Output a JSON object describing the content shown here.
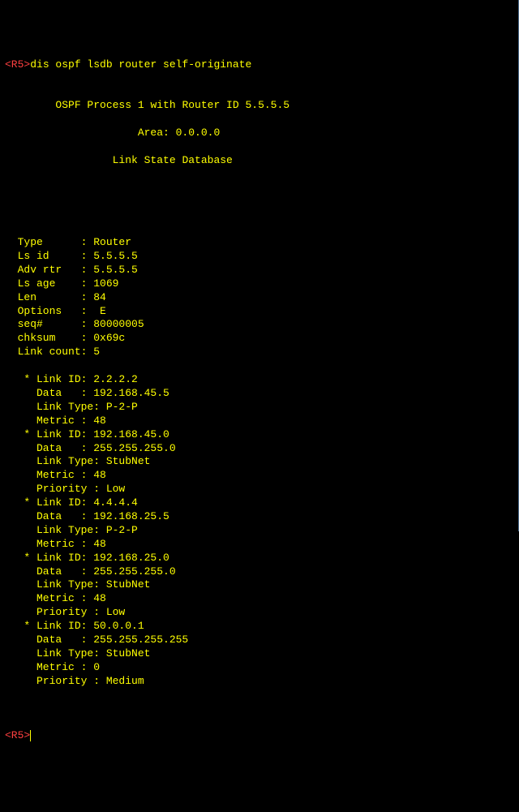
{
  "prompt": {
    "host": "<R5>",
    "command": "dis ospf lsdb router self-originate",
    "end_host": "<R5>"
  },
  "header": {
    "line1": "OSPF Process 1 with Router ID 5.5.5.5",
    "line2": "Area: 0.0.0.0",
    "line3": "Link State Database"
  },
  "fields": [
    {
      "label": "Type      ",
      "sep": ": ",
      "value": "Router"
    },
    {
      "label": "Ls id     ",
      "sep": ": ",
      "value": "5.5.5.5"
    },
    {
      "label": "Adv rtr   ",
      "sep": ": ",
      "value": "5.5.5.5"
    },
    {
      "label": "Ls age    ",
      "sep": ": ",
      "value": "1069"
    },
    {
      "label": "Len       ",
      "sep": ": ",
      "value": "84"
    },
    {
      "label": "Options   ",
      "sep": ":  ",
      "value": "E"
    },
    {
      "label": "seq#      ",
      "sep": ": ",
      "value": "80000005"
    },
    {
      "label": "chksum    ",
      "sep": ": ",
      "value": "0x69c"
    },
    {
      "label": "Link count",
      "sep": ": ",
      "value": "5"
    }
  ],
  "links": [
    {
      "rows": [
        {
          "label": "* Link ID",
          "sep": ": ",
          "value": "2.2.2.2"
        },
        {
          "label": "  Data   ",
          "sep": ": ",
          "value": "192.168.45.5"
        },
        {
          "label": "  Link Type",
          "sep": ": ",
          "value": "P-2-P"
        },
        {
          "label": "  Metric ",
          "sep": ": ",
          "value": "48"
        }
      ]
    },
    {
      "rows": [
        {
          "label": "* Link ID",
          "sep": ": ",
          "value": "192.168.45.0"
        },
        {
          "label": "  Data   ",
          "sep": ": ",
          "value": "255.255.255.0"
        },
        {
          "label": "  Link Type",
          "sep": ": ",
          "value": "StubNet"
        },
        {
          "label": "  Metric ",
          "sep": ": ",
          "value": "48"
        },
        {
          "label": "  Priority ",
          "sep": ": ",
          "value": "Low"
        }
      ]
    },
    {
      "rows": [
        {
          "label": "* Link ID",
          "sep": ": ",
          "value": "4.4.4.4"
        },
        {
          "label": "  Data   ",
          "sep": ": ",
          "value": "192.168.25.5"
        },
        {
          "label": "  Link Type",
          "sep": ": ",
          "value": "P-2-P"
        },
        {
          "label": "  Metric ",
          "sep": ": ",
          "value": "48"
        }
      ]
    },
    {
      "rows": [
        {
          "label": "* Link ID",
          "sep": ": ",
          "value": "192.168.25.0"
        },
        {
          "label": "  Data   ",
          "sep": ": ",
          "value": "255.255.255.0"
        },
        {
          "label": "  Link Type",
          "sep": ": ",
          "value": "StubNet"
        },
        {
          "label": "  Metric ",
          "sep": ": ",
          "value": "48"
        },
        {
          "label": "  Priority ",
          "sep": ": ",
          "value": "Low"
        }
      ]
    },
    {
      "rows": [
        {
          "label": "* Link ID",
          "sep": ": ",
          "value": "50.0.0.1"
        },
        {
          "label": "  Data   ",
          "sep": ": ",
          "value": "255.255.255.255"
        },
        {
          "label": "  Link Type",
          "sep": ": ",
          "value": "StubNet"
        },
        {
          "label": "  Metric ",
          "sep": ": ",
          "value": "0"
        },
        {
          "label": "  Priority ",
          "sep": ": ",
          "value": "Medium"
        }
      ]
    }
  ]
}
